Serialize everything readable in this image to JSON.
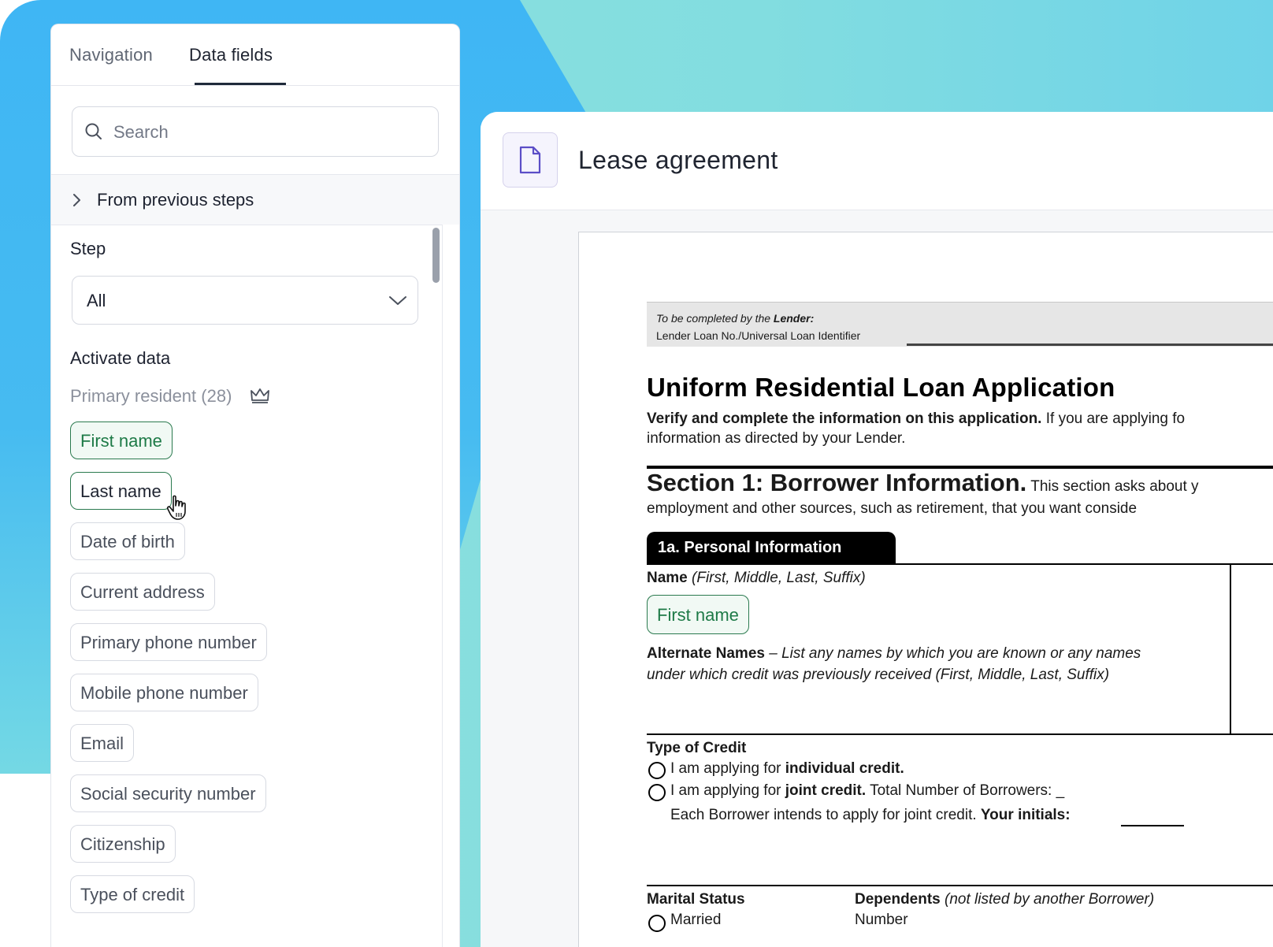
{
  "panel": {
    "tabs": [
      "Navigation",
      "Data fields"
    ],
    "active_tab": "Data fields",
    "search": {
      "placeholder": "Search"
    },
    "previous_steps_label": "From previous steps",
    "step_label": "Step",
    "step_value": "All",
    "activate_label": "Activate data",
    "primary_resident_label": "Primary resident (28)",
    "fields": [
      "First name",
      "Last name",
      "Date of birth",
      "Current address",
      "Primary phone number",
      "Mobile phone number",
      "Email",
      "Social security number",
      "Citizenship",
      "Type of credit"
    ]
  },
  "document": {
    "title": "Lease agreement",
    "form": {
      "lender_line1_a": "To be completed by the ",
      "lender_line1_b": "Lender:",
      "lender_line2": "Lender Loan No./Universal Loan Identifier",
      "title": "Uniform Residential Loan Application",
      "verify_bold": "Verify and complete the information on this application.",
      "verify_rest": " If you are applying fo",
      "verify_line2": "information as directed by your Lender.",
      "section_bold": "Section 1: Borrower Information.",
      "section_rest": " This section asks about y",
      "section_line2": "employment and other sources, such as retirement, that you want conside",
      "personal_info_tab": "1a. Personal Information",
      "name_label": "Name",
      "name_hint": " (First, Middle, Last, Suffix)",
      "first_name_chip": "First name",
      "alt_names_label": "Alternate Names",
      "alt_names_hint1": " – List any names by which you are known or any names",
      "alt_names_hint2": "under which credit was previously received  (First, Middle, Last, Suffix)",
      "type_of_credit": "Type of Credit",
      "radio1_a": "I am applying for ",
      "radio1_b": "individual credit.",
      "radio2_a": "I am applying for ",
      "radio2_b": "joint credit.",
      "radio2_c": " Total Number of Borrowers: _",
      "initials_a": "Each Borrower intends to apply for joint credit. ",
      "initials_b": "Your initials:",
      "marital_status": "Marital Status",
      "dependents": "Dependents",
      "dependents_hint": " (not listed by another Borrower)",
      "married": "Married",
      "number": "Number"
    }
  },
  "colors": {
    "accent_green": "#1e7a47",
    "background_blue": "#3fb6f4",
    "background_teal": "#8fe1dc",
    "doc_icon_purple": "#5b4ec7"
  },
  "icons": {
    "search": "search-icon",
    "chevron_right": "chevron-right-icon",
    "chevron_down": "chevron-down-icon",
    "crown": "crown-icon",
    "document": "document-icon",
    "cursor": "hand-pointer-icon"
  }
}
